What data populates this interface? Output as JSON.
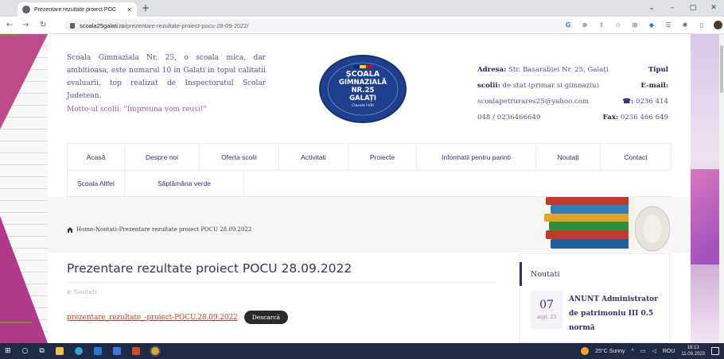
{
  "browser": {
    "tab_title": "Prezentare rezultate proiect POC",
    "new_tab": "+",
    "url_domain": "scoala25galati.ro",
    "url_path": "/prezentare-rezultate-proiect-pocu-28-09-2022/"
  },
  "site": {
    "intro": "Scoala Gimnaziala Nr. 25, o scoala mica, dar ambitioasa, este numarul 10 in Galati in topul calitatii evaluarii, top realizat de Inspectoratul Scolar Judetean.",
    "motto": "Motto-ul scolii: \"Impreuna vom reusi!\"",
    "logo": {
      "line1": "ȘCOALA",
      "line2": "GIMNAZIALĂ",
      "line3": "NR.25",
      "line4": "GALAȚI",
      "line5": "Clasele I-VIII"
    },
    "contact": {
      "address_label": "Adresa:",
      "address_value": "Str. Basarabiei Nr. 25, Galați",
      "type_label": "Tipul",
      "type_label2": "scolii:",
      "type_value": "de stat (primar si gimnaziu)",
      "email_label": "E-mail:",
      "email_value": "scoalapetrurares25@yahoo.com",
      "phone_icon": "☎",
      "phone_label": ":",
      "phone_value": "0236 414",
      "phone_value2": "048 / 0236466649",
      "fax_label": "Fax:",
      "fax_value": "0236 466 649"
    }
  },
  "nav": {
    "row1": [
      "Acasă",
      "Despre noi",
      "Oferta scolii",
      "Activitati",
      "Proiecte",
      "Informatii pentru parinti",
      "Noutați",
      "Contact"
    ],
    "row2": [
      "Școala Altfel",
      "Săptămâna verde"
    ]
  },
  "breadcrumb": {
    "home": "Home",
    "sep1": " › ",
    "section": "Noutati",
    "sep2": " › ",
    "current": "Prezentare rezultate proiect POCU 28.09.2022"
  },
  "post": {
    "title": "Prezentare rezultate proiect POCU 28.09.2022",
    "category": "Noutati",
    "file_link": "prezentare_rezultate_-proiect-POCU.28.09.2022",
    "download_label": "Descarcă"
  },
  "sidebar": {
    "heading": "Noutati",
    "date_day": "07",
    "date_month": "sept. 23",
    "news_title": "ANUNT Administrator de patrimoniu III 0.5 normă"
  },
  "taskbar": {
    "weather": "25°C Sunny",
    "lang": "ROU",
    "time": "18:13",
    "date": "11.09.2023"
  },
  "colors": {
    "accent": "#3a2d6a",
    "link": "#c0392b",
    "taskbar": "#1f2b45"
  }
}
